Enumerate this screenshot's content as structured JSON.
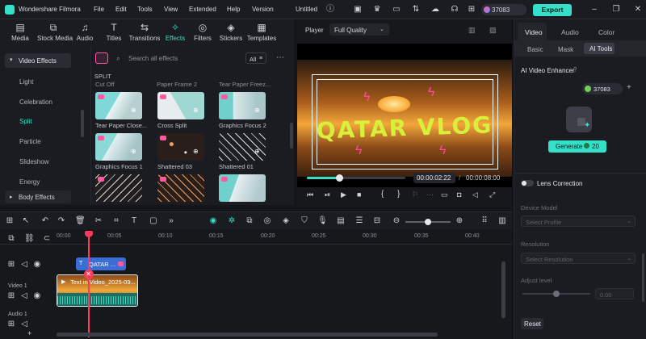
{
  "app": {
    "name": "Wondershare Filmora",
    "menu": [
      "File",
      "Edit",
      "Tools",
      "View",
      "Extended",
      "Help",
      "Version"
    ],
    "project_title": "Untitled",
    "credits": "37083",
    "export_label": "Export"
  },
  "toolbar": {
    "tabs": [
      {
        "label": "Media",
        "icon": "media-icon"
      },
      {
        "label": "Stock Media",
        "icon": "stock-media-icon"
      },
      {
        "label": "Audio",
        "icon": "audio-icon"
      },
      {
        "label": "Titles",
        "icon": "titles-icon"
      },
      {
        "label": "Transitions",
        "icon": "transitions-icon"
      },
      {
        "label": "Effects",
        "icon": "effects-icon"
      },
      {
        "label": "Filters",
        "icon": "filters-icon"
      },
      {
        "label": "Stickers",
        "icon": "stickers-icon"
      },
      {
        "label": "Templates",
        "icon": "templates-icon"
      }
    ],
    "active_tab": "Effects"
  },
  "categories": {
    "header": "Video Effects",
    "items": [
      "Light",
      "Celebration",
      "Split",
      "Particle",
      "Slideshow",
      "Energy"
    ],
    "active": "Split",
    "body_effects": "Body Effects"
  },
  "effects": {
    "search_placeholder": "Search all effects",
    "filter_label": "All",
    "section": "SPLIT",
    "top_partial": [
      "Cut Off",
      "Paper Frame 2",
      "Tear Paper Freez..."
    ],
    "rows": [
      [
        "Tear Paper Close...",
        "Cross Split",
        "Graphics Focus 2"
      ],
      [
        "Graphics Focus 1",
        "Shattered 03",
        "Shattered 01"
      ],
      [
        "",
        "",
        ""
      ]
    ]
  },
  "player": {
    "label": "Player",
    "quality": "Full Quality",
    "title_text": "QATAR VLOG",
    "current_time": "00:00:02:22",
    "total_time": "00:00:08:00",
    "progress": 0.33
  },
  "right_panel": {
    "tabs": [
      "Video",
      "Audio",
      "Color"
    ],
    "active_tab": "Video",
    "subtabs": [
      "Basic",
      "Mask",
      "AI Tools"
    ],
    "active_subtab": "AI Tools",
    "ai_enhancer": "AI Video Enhancer",
    "credits": "37083",
    "generate_label": "Generate",
    "generate_cost": "20",
    "lens_correction": "Lens Correction",
    "device_model_label": "Device Model",
    "device_model_value": "Select Profile",
    "resolution_label": "Resolution",
    "resolution_value": "Select Resolution",
    "adjust_level_label": "Adjust level",
    "adjust_level_value": "0.00",
    "reset_label": "Reset"
  },
  "timeline": {
    "ruler": [
      "00:00",
      "00:05",
      "00:10",
      "00:15",
      "00:20",
      "00:25",
      "00:30",
      "00:35",
      "00:40"
    ],
    "title_clip": "QATAR ...",
    "video_clip": "Text in Video_2025-09...",
    "track_video": "Video 1",
    "track_audio": "Audio 1",
    "playhead": 0.075
  },
  "colors": {
    "accent": "#35e0c8",
    "pink": "#ff5aa0",
    "bg": "#141519"
  }
}
